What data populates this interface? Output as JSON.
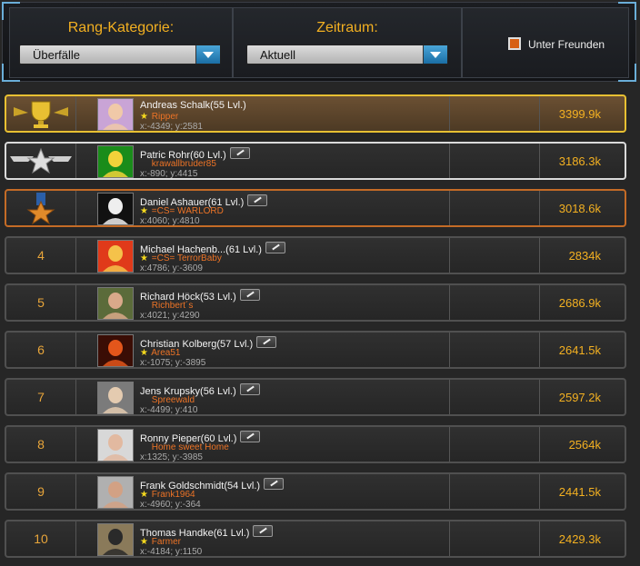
{
  "filters": {
    "category_label": "Rang-Kategorie:",
    "category_value": "Überfälle",
    "period_label": "Zeitraum:",
    "period_value": "Aktuell",
    "friends_label": "Unter Freunden"
  },
  "colors": {
    "accent": "#f3b021",
    "alliance": "#ec7326",
    "gold": "#e8c032",
    "bronze": "#c46b26",
    "silver": "#dadada"
  },
  "rows": [
    {
      "rank": "1",
      "rank_icon": "gold-trophy-icon",
      "name": "Andreas Schalk",
      "level": "(55 Lvl.)",
      "alliance": "Ripper",
      "star": true,
      "coords": "x:-4349; y:2581",
      "score": "3399.9k",
      "edit": false
    },
    {
      "rank": "2",
      "rank_icon": "silver-star-wings-icon",
      "name": "Patric Rohr",
      "level": "(60 Lvl.)",
      "alliance": "krawallbruder85",
      "star": false,
      "coords": "x:-890; y:4415",
      "score": "3186.3k",
      "edit": true
    },
    {
      "rank": "3",
      "rank_icon": "bronze-star-medal-icon",
      "name": "Daniel Ashauer",
      "level": "(61 Lvl.)",
      "alliance": "=CS= WARLORD",
      "star": true,
      "coords": "x:4060; y:4810",
      "score": "3018.6k",
      "edit": true
    },
    {
      "rank": "4",
      "name": "Michael Hachenb...",
      "level": "(61 Lvl.)",
      "alliance": "=CS= TerrorBaby",
      "star": true,
      "coords": "x:4786; y:-3609",
      "score": "2834k",
      "edit": true
    },
    {
      "rank": "5",
      "name": "Richard Höck",
      "level": "(53 Lvl.)",
      "alliance": "Richbert´s",
      "star": false,
      "coords": "x:4021; y:4290",
      "score": "2686.9k",
      "edit": true
    },
    {
      "rank": "6",
      "name": "Christian Kolberg",
      "level": "(57 Lvl.)",
      "alliance": "Area51",
      "star": true,
      "coords": "x:-1075; y:-3895",
      "score": "2641.5k",
      "edit": true
    },
    {
      "rank": "7",
      "name": "Jens Krupsky",
      "level": "(56 Lvl.)",
      "alliance": "Spreewald",
      "star": false,
      "coords": "x:-4499; y:410",
      "score": "2597.2k",
      "edit": true
    },
    {
      "rank": "8",
      "name": "Ronny Pieper",
      "level": "(60 Lvl.)",
      "alliance": "Home sweet Home",
      "star": false,
      "coords": "x:1325; y:-3985",
      "score": "2564k",
      "edit": true
    },
    {
      "rank": "9",
      "name": "Frank Goldschmidt",
      "level": "(54 Lvl.)",
      "alliance": "Frank1964",
      "star": true,
      "coords": "x:-4960; y:-364",
      "score": "2441.5k",
      "edit": true
    },
    {
      "rank": "10",
      "name": "Thomas Handke",
      "level": "(61 Lvl.)",
      "alliance": "Farmer",
      "star": true,
      "coords": "x:-4184; y:1150",
      "score": "2429.3k",
      "edit": true
    }
  ]
}
